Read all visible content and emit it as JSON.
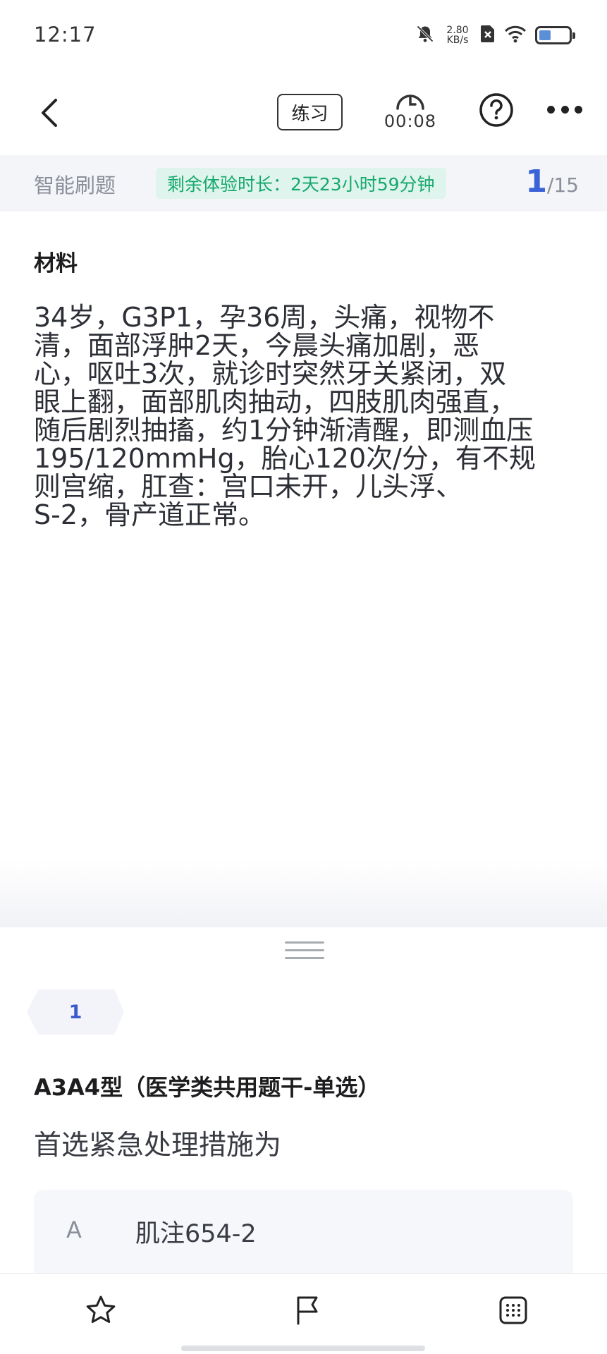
{
  "status_bar": {
    "time": "12:17",
    "net_speed_value": "2.80",
    "net_speed_unit": "KB/s"
  },
  "header": {
    "mode_label": "练习",
    "timer": "00:08"
  },
  "info_bar": {
    "label": "智能刷题",
    "trial_remaining": "剩余体验时长：2天23小时59分钟",
    "current": "1",
    "total": "/15"
  },
  "material": {
    "title": "材料",
    "lines": [
      "34岁，G3P1，孕36周，头痛，视物不",
      "清，面部浮肿2天，今晨头痛加剧，恶",
      "心，呕吐3次，就诊时突然牙关紧闭，双",
      "眼上翻，面部肌肉抽动，四肢肌肉强直，",
      "随后剧烈抽搐，约1分钟渐清醒，即测血压",
      "195/120mmHg，胎心120次/分，有不规",
      "则宫缩，肛查：宫口未开，儿头浮、",
      "S-2，骨产道正常。"
    ]
  },
  "question": {
    "number": "1",
    "type": "A3A4型（医学类共用题干-单选）",
    "text": "首选紧急处理措施为",
    "options": [
      {
        "letter": "A",
        "text": "肌注654-2"
      }
    ]
  },
  "colors": {
    "accent": "#3b63d8",
    "trial_green": "#16a86e",
    "trial_bg": "#dff4ec"
  }
}
